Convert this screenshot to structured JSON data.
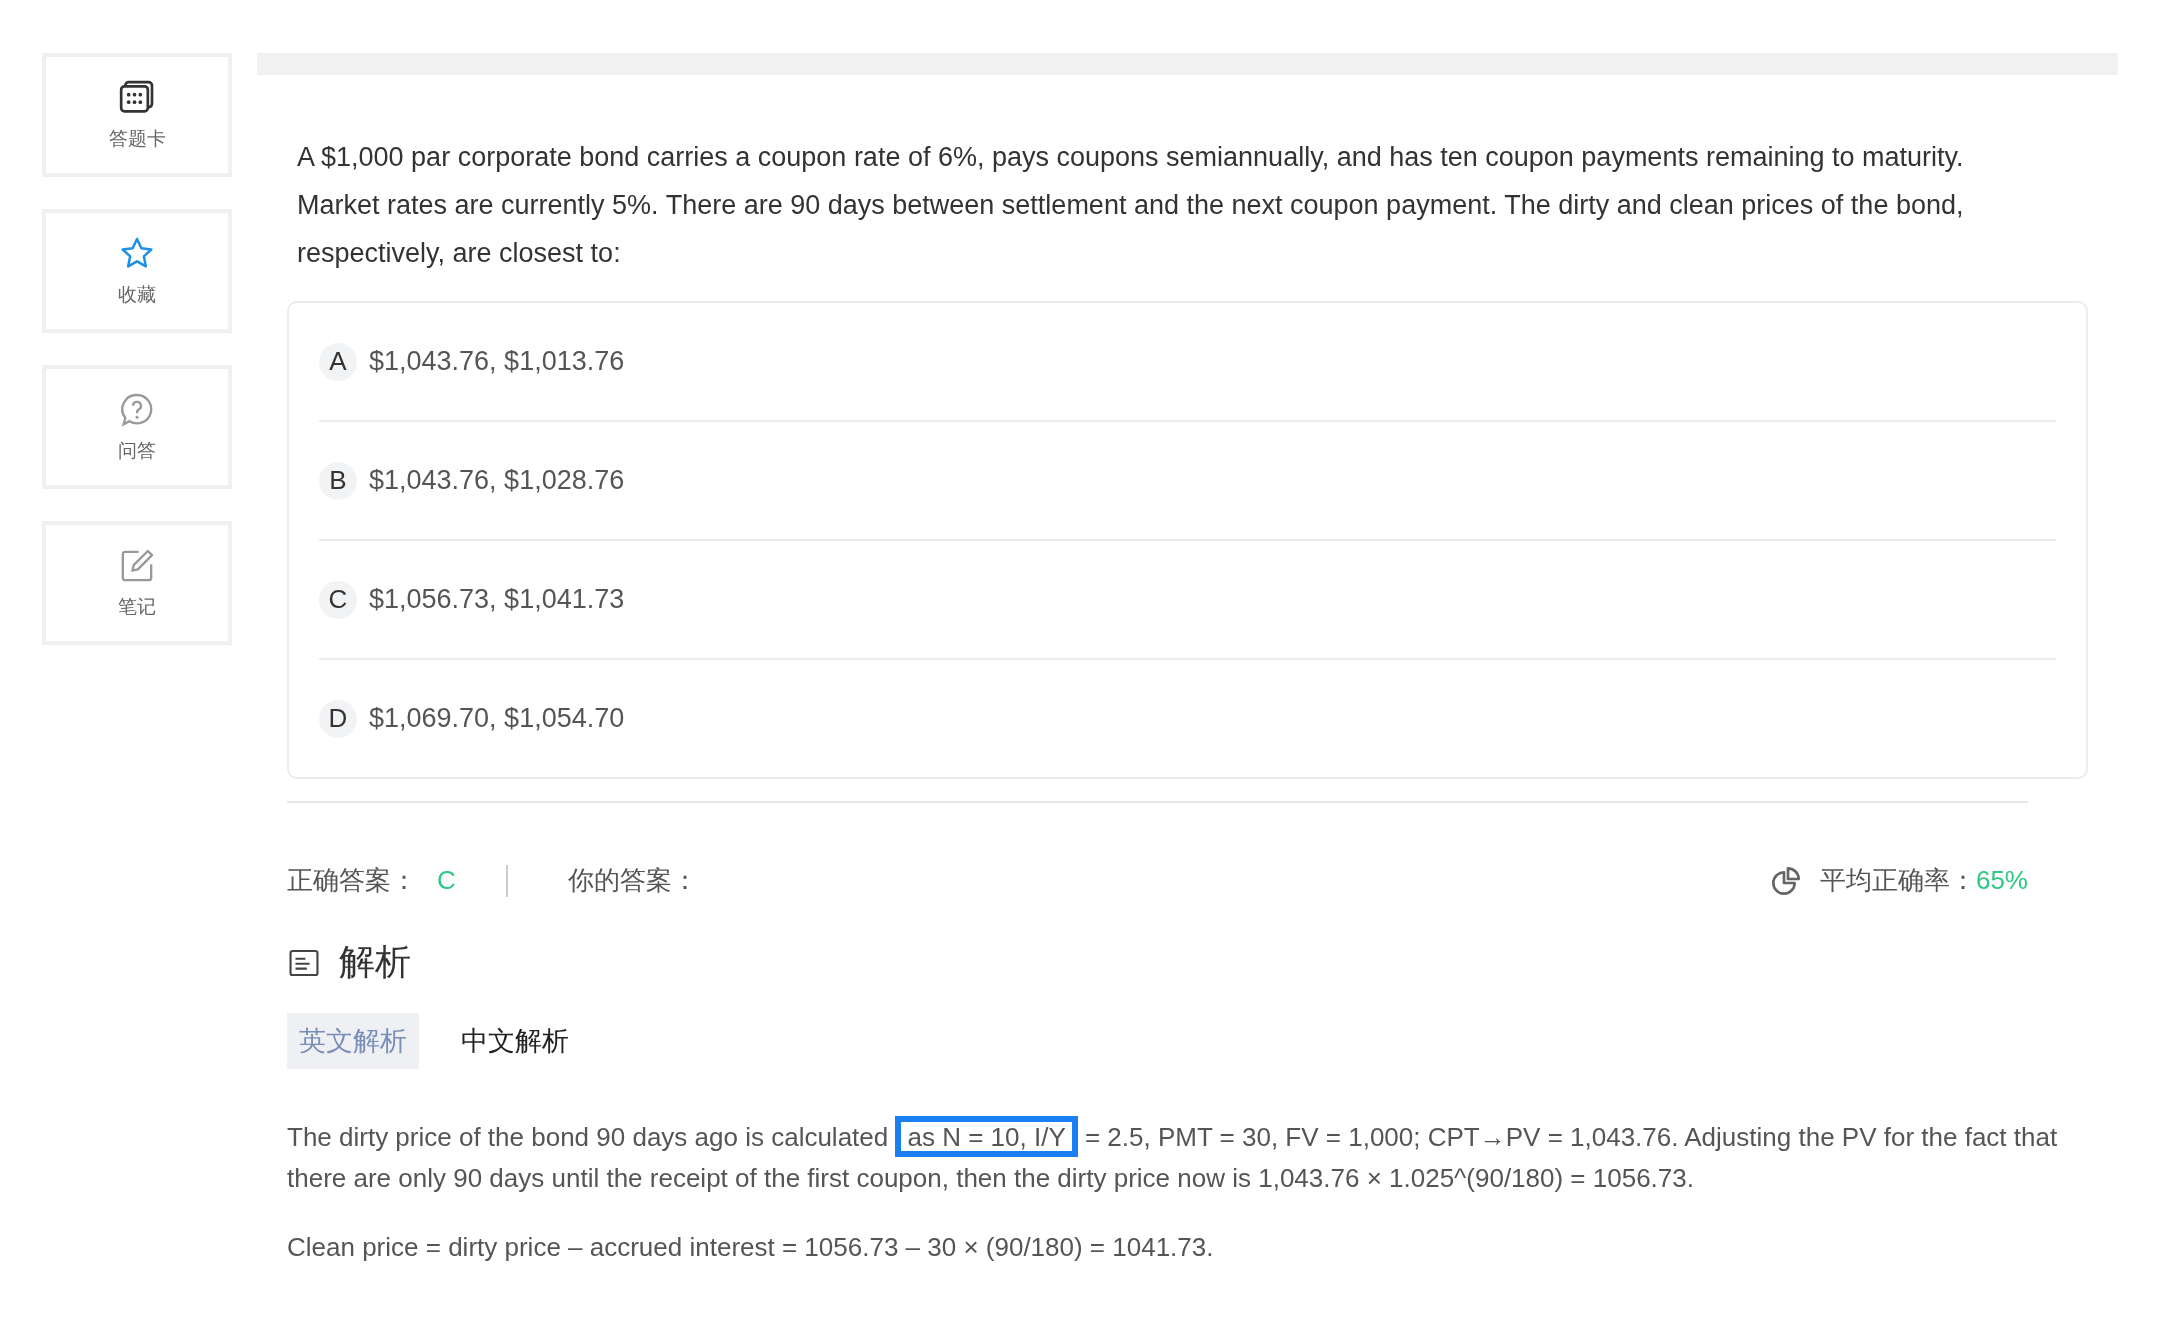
{
  "sidebar": {
    "items": [
      {
        "kind": "card",
        "label": "答题卡"
      },
      {
        "kind": "star",
        "label": "收藏"
      },
      {
        "kind": "question",
        "label": "问答"
      },
      {
        "kind": "note",
        "label": "笔记"
      }
    ]
  },
  "question": {
    "text": "A $1,000 par corporate bond carries a coupon rate of 6%, pays coupons semiannually, and has ten coupon payments remaining to maturity. Market rates are currently 5%. There are 90 days between settlement and the next coupon payment. The dirty and clean prices of the bond, respectively, are closest to:",
    "options": [
      {
        "letter": "A",
        "text": "$1,043.76, $1,013.76"
      },
      {
        "letter": "B",
        "text": "$1,043.76, $1,028.76"
      },
      {
        "letter": "C",
        "text": "$1,056.73, $1,041.73"
      },
      {
        "letter": "D",
        "text": "$1,069.70, $1,054.70"
      }
    ]
  },
  "answer": {
    "correct_label": "正确答案：",
    "correct": "C",
    "yours_label": "你的答案：",
    "average_label": "平均正确率：",
    "average": "65%"
  },
  "explanation": {
    "title": "解析",
    "tabs": [
      {
        "label": "英文解析",
        "selected": true
      },
      {
        "label": "中文解析",
        "selected": false
      }
    ],
    "paragraph_before": "The dirty price of the bond 90 days ago is calculated ",
    "highlighted": "as N = 10, I/Y",
    "paragraph_after": " = 2.5, PMT = 30, FV = 1,000; CPT→PV = 1,043.76. Adjusting the PV for the fact that there are only 90 days until the receipt of the first coupon, then the dirty price now is 1,043.76 × 1.025^(90/180) = 1056.73.",
    "clean_price": "Clean price = dirty price – accrued interest = 1056.73 – 30 × (90/180) = 1041.73."
  }
}
